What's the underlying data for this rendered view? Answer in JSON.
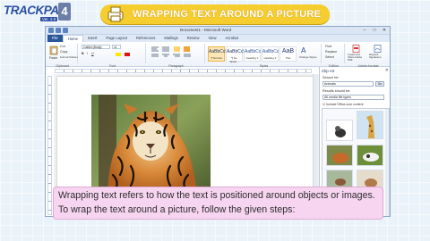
{
  "logo": {
    "text": "TRACKPAD",
    "version": "4",
    "sub": "Ver. 2.0"
  },
  "banner": {
    "title": "WRAPPING TEXT AROUND A PICTURE",
    "icon": "printer-icon"
  },
  "word": {
    "window_title": "Document1 - Microsoft Word",
    "tabs": [
      "File",
      "Home",
      "Insert",
      "Page Layout",
      "References",
      "Mailings",
      "Review",
      "View",
      "Acrobat"
    ],
    "active_tab": "Home",
    "ribbon": {
      "clipboard": {
        "label": "Clipboard",
        "paste": "Paste",
        "cut": "Cut",
        "copy": "Copy",
        "format_painter": "Format Painter"
      },
      "font": {
        "label": "Font",
        "name": "Calibri (Body)",
        "size": "11"
      },
      "paragraph": {
        "label": "Paragraph"
      },
      "styles": {
        "label": "Styles",
        "items": [
          {
            "sample": "AaBbCcDc",
            "name": "¶ Normal"
          },
          {
            "sample": "AaBbCcDc",
            "name": "¶ No Spaci..."
          },
          {
            "sample": "AaBbCc",
            "name": "Heading 1"
          },
          {
            "sample": "AaBbCc",
            "name": "Heading 2"
          },
          {
            "sample": "AaB",
            "name": "Title"
          }
        ],
        "change_styles": "Change Styles"
      },
      "editing": {
        "label": "Editing",
        "find": "Find",
        "replace": "Replace",
        "select": "Select"
      },
      "acrobat": {
        "label": "Adobe Acrobat",
        "create": "Create and Share Adobe PDF",
        "request": "Request Signatures"
      }
    },
    "clip_art": {
      "title": "Clip Art",
      "search_for_label": "Search for:",
      "search_value": "Animals",
      "go": "Go",
      "results_label": "Results should be:",
      "results_value": "All media file types",
      "include_office": "Include Office.com content"
    }
  },
  "caption": "Wrapping text refers to how the text is positioned around objects or images. To wrap the text around a picture, follow the given steps:",
  "colors": {
    "banner": "#f6cd2f",
    "caption_bg": "#f7d5f1",
    "word_blue": "#2b579a"
  }
}
